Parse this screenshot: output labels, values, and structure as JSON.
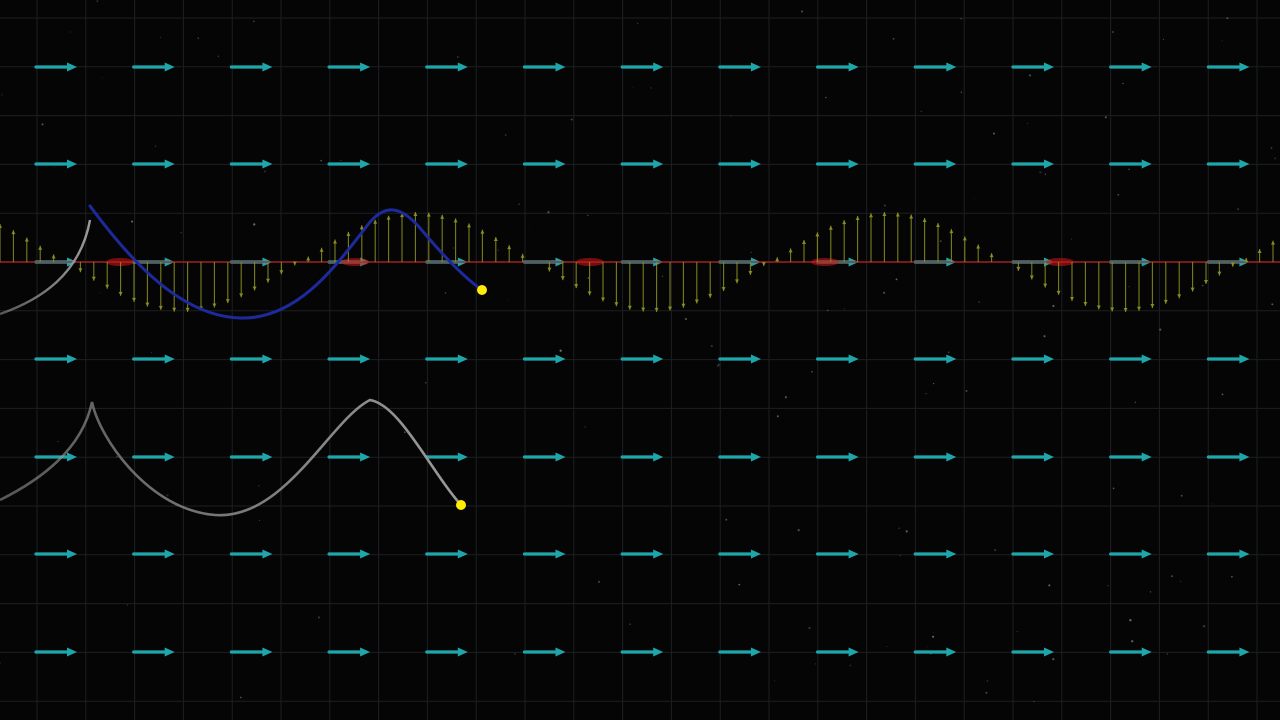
{
  "scene": {
    "background_color": "#050505",
    "grid_color": "#1c1f22",
    "background_field_arrow_color": "#1fa6aa",
    "wave_field_arrow_color": "#8f9422",
    "axis_line_color": "#b0231f",
    "particle_path_color": "#1c2a9c",
    "ghost_path_color": "#9a9a9a",
    "particle_marker_color": "#ffee00",
    "background_field_direction": "right",
    "background_field_rows": 7,
    "background_field_columns": 13,
    "wave_field_arrow_count": 96,
    "wave_field_sign_pattern": [
      "negative",
      "positive",
      "negative",
      "positive",
      "negative",
      "positive"
    ]
  },
  "icons": {
    "field_arrow": "arrow-right-icon",
    "particle": "dot-icon"
  }
}
